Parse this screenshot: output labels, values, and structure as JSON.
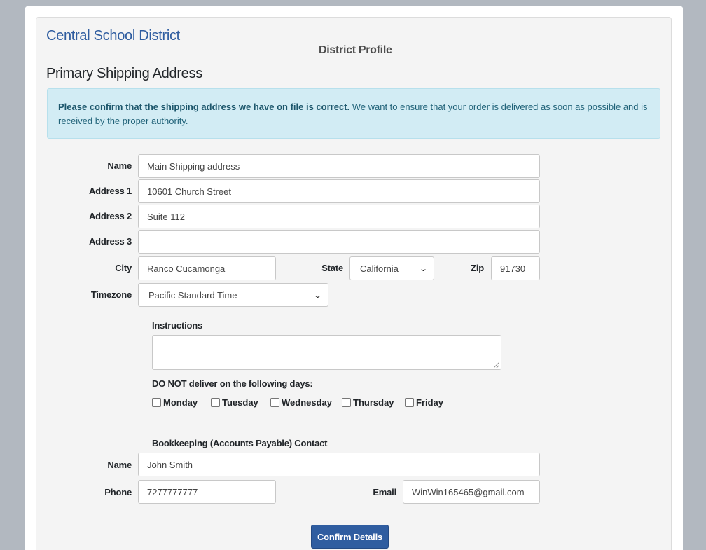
{
  "header": {
    "district_name": "Central School District",
    "page_title": "District Profile",
    "section_title": "Primary Shipping Address"
  },
  "alert": {
    "bold_text": "Please confirm that the shipping address we have on file is correct.",
    "text": " We want to ensure that your order is delivered as soon as possible and is received by the proper authority."
  },
  "shipping": {
    "name_label": "Name",
    "name_value": "Main Shipping address",
    "address1_label": "Address 1",
    "address1_value": "10601 Church Street",
    "address2_label": "Address 2",
    "address2_value": "Suite 112",
    "address3_label": "Address 3",
    "address3_value": "",
    "city_label": "City",
    "city_value": "Ranco Cucamonga",
    "state_label": "State",
    "state_value": "California",
    "zip_label": "Zip",
    "zip_value": "91730",
    "timezone_label": "Timezone",
    "timezone_value": "Pacific Standard Time"
  },
  "instructions": {
    "label": "Instructions",
    "value": ""
  },
  "delivery_days": {
    "label": "DO NOT deliver on the following days:",
    "days": [
      {
        "label": "Monday",
        "checked": false
      },
      {
        "label": "Tuesday",
        "checked": false
      },
      {
        "label": "Wednesday",
        "checked": false
      },
      {
        "label": "Thursday",
        "checked": false
      },
      {
        "label": "Friday",
        "checked": false
      }
    ]
  },
  "bookkeeping": {
    "title": "Bookkeeping (Accounts Payable) Contact",
    "name_label": "Name",
    "name_value": "John Smith",
    "phone_label": "Phone",
    "phone_value": "7277777777",
    "email_label": "Email",
    "email_value": "WinWin165465@gmail.com"
  },
  "actions": {
    "confirm_label": "Confirm Details"
  },
  "colors": {
    "brand": "#2f5da0",
    "alert_bg": "#d2ecf4",
    "page_bg": "#b2b8c0"
  }
}
